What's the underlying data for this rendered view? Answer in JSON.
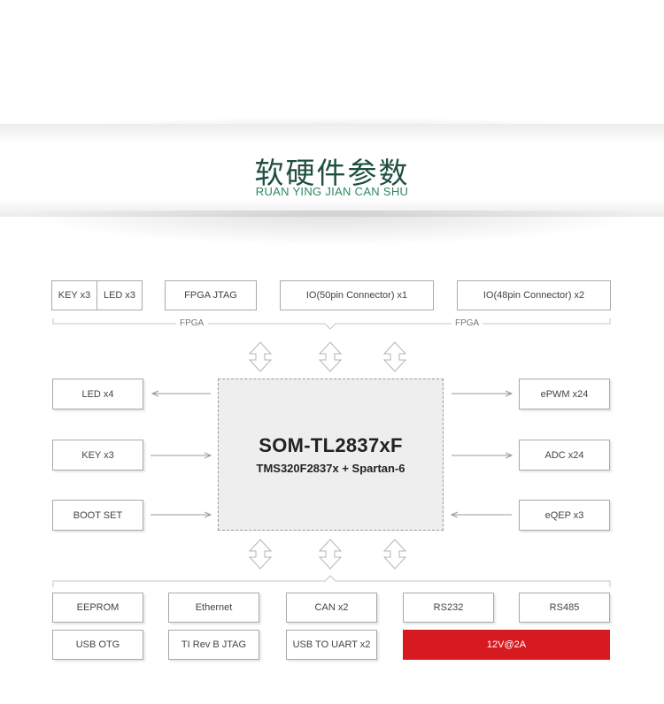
{
  "header": {
    "title_zh": "软硬件参数",
    "title_pinyin": "RUAN YING JIAN CAN SHU"
  },
  "top_row": {
    "key": "KEY x3",
    "led": "LED x3",
    "fpga_jtag": "FPGA JTAG",
    "io50": "IO(50pin Connector) x1",
    "io48": "IO(48pin Connector) x2",
    "fpga_label_left": "FPGA",
    "fpga_label_right": "FPGA"
  },
  "core": {
    "name": "SOM-TL2837xF",
    "subtitle": "TMS320F2837x + Spartan-6"
  },
  "left_side": {
    "led": "LED x4",
    "key": "KEY x3",
    "boot": "BOOT SET"
  },
  "right_side": {
    "epwm": "ePWM x24",
    "adc": "ADC x24",
    "eqep": "eQEP x3"
  },
  "bottom_row1": [
    "EEPROM",
    "Ethernet",
    "CAN x2",
    "RS232",
    "RS485"
  ],
  "bottom_row2": [
    "USB OTG",
    "TI Rev B JTAG",
    "USB TO UART x2",
    "12V@2A"
  ],
  "colors": {
    "title_green": "#1f4f3f",
    "pinyin_green": "#2a8a5a",
    "power_red": "#d71a1f",
    "border_gray": "#a9a9a9",
    "chip_fill": "#eeeeee"
  }
}
